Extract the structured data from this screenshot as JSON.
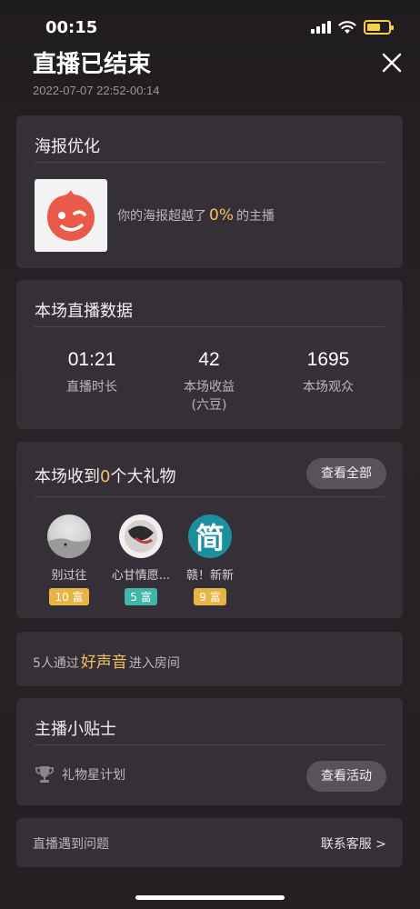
{
  "status": {
    "time": "00:15"
  },
  "header": {
    "title": "直播已结束",
    "datetime": "2022-07-07 22:52-00:14"
  },
  "poster": {
    "title": "海报优化",
    "text_prefix": "你的海报超越了",
    "percent": "0%",
    "text_suffix": "的主播"
  },
  "stats": {
    "title": "本场直播数据",
    "items": [
      {
        "value": "01:21",
        "label": "直播时长",
        "sub": ""
      },
      {
        "value": "42",
        "label": "本场收益",
        "sub": "(六豆)"
      },
      {
        "value": "1695",
        "label": "本场观众",
        "sub": ""
      }
    ]
  },
  "gifts": {
    "title_prefix": "本场收到",
    "count": "0",
    "title_suffix": "个大礼物",
    "view_all": "查看全部",
    "items": [
      {
        "name": "别过往",
        "badge": "10 富",
        "badge_color": "#e7b544"
      },
      {
        "name": "心甘情愿...",
        "badge": "5 富",
        "badge_color": "#3fb6a7"
      },
      {
        "name": "赣！新新",
        "badge": "9 富",
        "badge_color": "#e7b544",
        "avatar_char": "简"
      }
    ]
  },
  "voice": {
    "prefix": "5人通过",
    "highlight": "好声音",
    "suffix": "进入房间"
  },
  "tips": {
    "title": "主播小贴士",
    "item_label": "礼物星计划",
    "view_activity": "查看活动"
  },
  "help": {
    "text": "直播遇到问题",
    "link": "联系客服 >"
  },
  "colors": {
    "accent": "#f4c062",
    "card": "#353037",
    "button": "#5a5159"
  }
}
